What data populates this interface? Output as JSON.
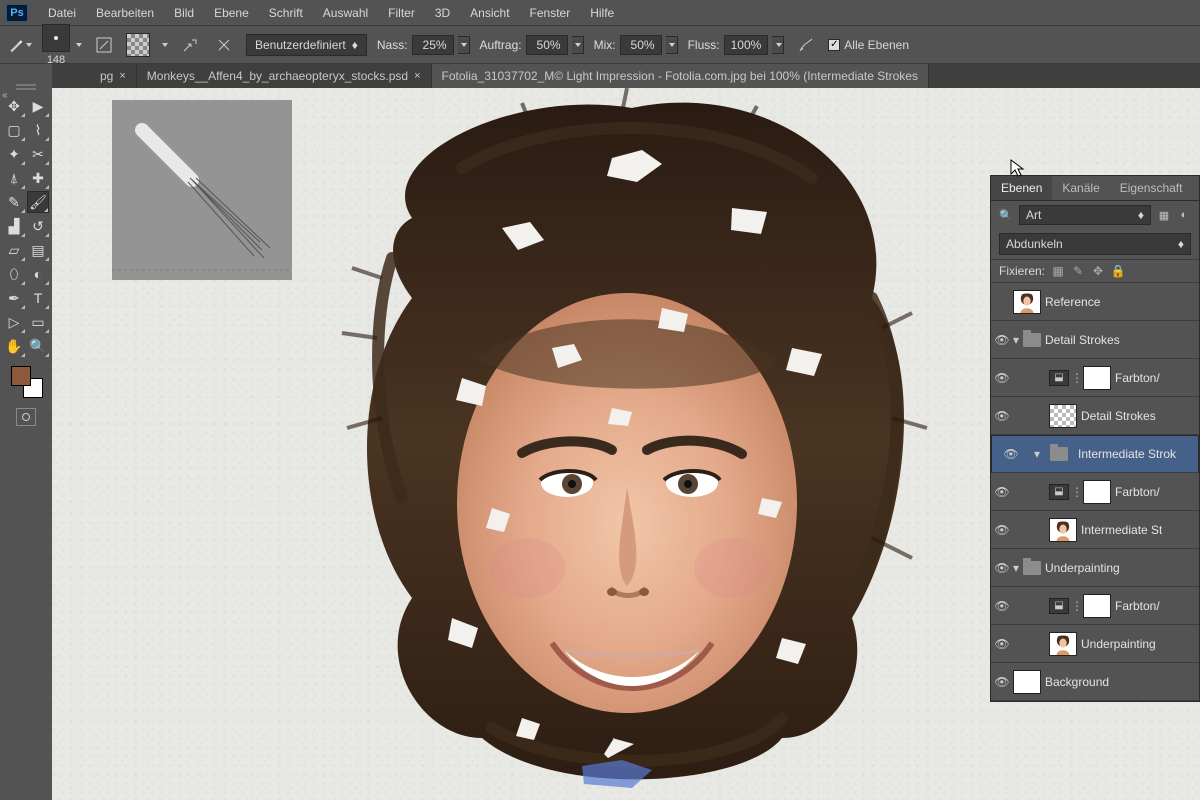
{
  "app": {
    "logo": "Ps"
  },
  "menu": [
    "Datei",
    "Bearbeiten",
    "Bild",
    "Ebene",
    "Schrift",
    "Auswahl",
    "Filter",
    "3D",
    "Ansicht",
    "Fenster",
    "Hilfe"
  ],
  "options": {
    "brush_size": "148",
    "preset_label": "Benutzerdefiniert",
    "nass_label": "Nass:",
    "nass_val": "25%",
    "auftrag_label": "Auftrag:",
    "auftrag_val": "50%",
    "mix_label": "Mix:",
    "mix_val": "50%",
    "fluss_label": "Fluss:",
    "fluss_val": "100%",
    "alle_ebenen": "Alle Ebenen"
  },
  "tabs": [
    {
      "label": "pg",
      "active": false
    },
    {
      "label": "Monkeys__Affen4_by_archaeopteryx_stocks.psd",
      "active": false
    },
    {
      "label": "Fotolia_31037702_M© Light Impression - Fotolia.com.jpg bei 100% (Intermediate Strokes",
      "active": true
    }
  ],
  "panel": {
    "tabs": [
      "Ebenen",
      "Kanäle",
      "Eigenschaft"
    ],
    "filter_label": "Art",
    "blend_mode": "Abdunkeln",
    "fix_label": "Fixieren:",
    "layers": [
      {
        "name": "Reference",
        "kind": "ref",
        "indent": 0,
        "visible": false
      },
      {
        "name": "Detail Strokes",
        "kind": "group",
        "indent": 0,
        "visible": true,
        "open": true
      },
      {
        "name": "Farbton/",
        "kind": "adj",
        "indent": 2,
        "visible": true
      },
      {
        "name": "Detail Strokes",
        "kind": "chk",
        "indent": 2,
        "visible": true
      },
      {
        "name": "Intermediate Strok",
        "kind": "group",
        "indent": 0,
        "visible": true,
        "open": true,
        "selected": true
      },
      {
        "name": "Farbton/",
        "kind": "adj",
        "indent": 2,
        "visible": true
      },
      {
        "name": "Intermediate St",
        "kind": "ref",
        "indent": 2,
        "visible": true
      },
      {
        "name": "Underpainting",
        "kind": "group",
        "indent": 0,
        "visible": true,
        "open": true
      },
      {
        "name": "Farbton/",
        "kind": "adj",
        "indent": 2,
        "visible": true
      },
      {
        "name": "Underpainting",
        "kind": "ref",
        "indent": 2,
        "visible": true
      },
      {
        "name": "Background",
        "kind": "white",
        "indent": 0,
        "visible": true
      }
    ]
  }
}
